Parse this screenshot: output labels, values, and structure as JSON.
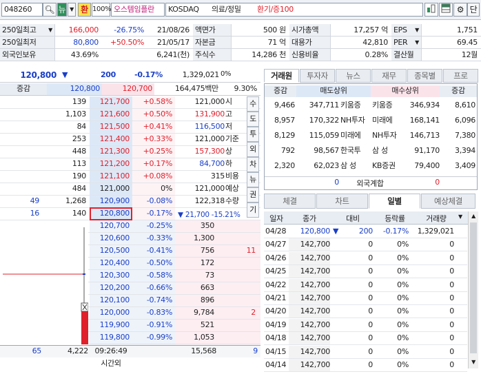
{
  "topbar": {
    "code": "048260",
    "search_icon": "search-icon",
    "new_label": "뉴",
    "hwan_label": "환",
    "pct": "100%",
    "name": "오스템임플란",
    "market": "KOSDAQ",
    "sector": "의료/정밀",
    "status": "환기/증100",
    "dan": "단"
  },
  "info": {
    "r1": {
      "l1": "250일최고",
      "v1": "166,000",
      "p1": "-26.75%",
      "d1": "21/08/26",
      "l2": "액면가",
      "v2": "500 원",
      "l3": "시가총액",
      "v3": "17,257 억",
      "l4": "EPS",
      "v4": "1,751"
    },
    "r2": {
      "l1": "250일최저",
      "v1": "80,800",
      "p1": "+50.50%",
      "d1": "21/05/17",
      "l2": "자본금",
      "v2": "71 억",
      "l3": "대용가",
      "v3": "42,810",
      "l4": "PER",
      "v4": "69.45"
    },
    "r3": {
      "l1": "외국인보유",
      "v1": "43.69%",
      "v1b": "6,241(천)",
      "l2": "주식수",
      "v2": "14,286 천",
      "l3": "신용비율",
      "v3": "0.28%",
      "l4": "결산월",
      "v4": "12월"
    }
  },
  "quote": {
    "price": "120,800",
    "arrow": "▼",
    "change": "200",
    "rate": "-0.17%",
    "volume": "1,329,021",
    "vol_pct": "0%",
    "label_inc": "증감",
    "ask_best": "120,800",
    "bid_best": "120,700",
    "amount": "164,475백만",
    "ratio": "9.30%"
  },
  "asks": [
    {
      "vol": "139",
      "price": "121,700",
      "rate": "+0.58%"
    },
    {
      "vol": "1,103",
      "price": "121,600",
      "rate": "+0.50%"
    },
    {
      "vol": "84",
      "price": "121,500",
      "rate": "+0.41%"
    },
    {
      "vol": "253",
      "price": "121,400",
      "rate": "+0.33%"
    },
    {
      "vol": "448",
      "price": "121,300",
      "rate": "+0.25%"
    },
    {
      "vol": "113",
      "price": "121,200",
      "rate": "+0.17%"
    },
    {
      "vol": "190",
      "price": "121,100",
      "rate": "+0.08%"
    },
    {
      "vol": "484",
      "price": "121,000",
      "rate": "0%"
    },
    {
      "chg": "49",
      "vol": "1,268",
      "price": "120,900",
      "rate": "-0.08%"
    },
    {
      "chg": "16",
      "vol": "140",
      "price": "120,800",
      "rate": "-0.17%"
    }
  ],
  "bids": [
    {
      "price": "120,700",
      "rate": "-0.25%",
      "vol": "350",
      "chg": ""
    },
    {
      "price": "120,600",
      "rate": "-0.33%",
      "vol": "1,300",
      "chg": ""
    },
    {
      "price": "120,500",
      "rate": "-0.41%",
      "vol": "756",
      "chg": "11"
    },
    {
      "price": "120,400",
      "rate": "-0.50%",
      "vol": "172",
      "chg": ""
    },
    {
      "price": "120,300",
      "rate": "-0.58%",
      "vol": "73",
      "chg": ""
    },
    {
      "price": "120,200",
      "rate": "-0.66%",
      "vol": "663",
      "chg": ""
    },
    {
      "price": "120,100",
      "rate": "-0.74%",
      "vol": "896",
      "chg": ""
    },
    {
      "price": "120,000",
      "rate": "-0.83%",
      "vol": "9,784",
      "chg": "2"
    },
    {
      "price": "119,900",
      "rate": "-0.91%",
      "vol": "521",
      "chg": ""
    },
    {
      "price": "119,800",
      "rate": "-0.99%",
      "vol": "1,053",
      "chg": ""
    }
  ],
  "ohlc": [
    {
      "v": "121,000",
      "l": "시"
    },
    {
      "v": "131,900",
      "l": "고"
    },
    {
      "v": "116,500",
      "l": "저"
    },
    {
      "v": "121,000",
      "l": "기준"
    },
    {
      "v": "157,300",
      "l": "상"
    },
    {
      "v": "84,700",
      "l": "하"
    },
    {
      "v": "315",
      "l": "비용"
    },
    {
      "v": "121,000",
      "l": "예상"
    },
    {
      "v": "122,318",
      "l": "수량"
    }
  ],
  "expected_change": "▼ 21,700 -15.21%",
  "side_buttons": [
    "수",
    "도",
    "투",
    "외",
    "차",
    "뉴",
    "권",
    "기"
  ],
  "footer": {
    "left": "65",
    "total_ask": "4,222",
    "time": "09:26:49",
    "total_bid": "15,568",
    "right": "9",
    "after": "시간외"
  },
  "tabs1": [
    "거래원",
    "투자자",
    "뉴스",
    "재무",
    "종목별",
    "프로"
  ],
  "broker_head": {
    "inc": "증감",
    "sell": "매도상위",
    "buy": "매수상위",
    "inc2": "증감"
  },
  "brokers": [
    {
      "sc": "9,466",
      "sv": "347,711",
      "sn": "키움증",
      "bn": "키움증",
      "bv": "346,934",
      "bc": "8,610"
    },
    {
      "sc": "8,957",
      "sv": "170,322",
      "sn": "NH투자",
      "bn": "미래에",
      "bv": "168,141",
      "bc": "6,096"
    },
    {
      "sc": "8,129",
      "sv": "115,059",
      "sn": "미래에",
      "bn": "NH투자",
      "bv": "146,713",
      "bc": "7,380"
    },
    {
      "sc": "792",
      "sv": "98,567",
      "sn": "한국투",
      "bn": "삼  성",
      "bv": "91,170",
      "bc": "3,394"
    },
    {
      "sc": "2,320",
      "sv": "62,023",
      "sn": "삼  성",
      "bn": "KB증권",
      "bv": "79,400",
      "bc": "3,409"
    }
  ],
  "foreign_total": {
    "sell": "0",
    "label": "외국계합",
    "buy": "0"
  },
  "tabs2": [
    "체결",
    "차트",
    "일별",
    "예상체결"
  ],
  "daily_head": [
    "일자",
    "종가",
    "대비",
    "등락률",
    "거래량"
  ],
  "daily": [
    {
      "d": "04/28",
      "c": "120,800",
      "a": "▼",
      "v": "200",
      "r": "-0.17%",
      "q": "1,329,021"
    },
    {
      "d": "04/27",
      "c": "142,700",
      "a": "",
      "v": "0",
      "r": "0%",
      "q": "0"
    },
    {
      "d": "04/26",
      "c": "142,700",
      "a": "",
      "v": "0",
      "r": "0%",
      "q": "0"
    },
    {
      "d": "04/25",
      "c": "142,700",
      "a": "",
      "v": "0",
      "r": "0%",
      "q": "0"
    },
    {
      "d": "04/22",
      "c": "142,700",
      "a": "",
      "v": "0",
      "r": "0%",
      "q": "0"
    },
    {
      "d": "04/21",
      "c": "142,700",
      "a": "",
      "v": "0",
      "r": "0%",
      "q": "0"
    },
    {
      "d": "04/20",
      "c": "142,700",
      "a": "",
      "v": "0",
      "r": "0%",
      "q": "0"
    },
    {
      "d": "04/19",
      "c": "142,700",
      "a": "",
      "v": "0",
      "r": "0%",
      "q": "0"
    },
    {
      "d": "04/18",
      "c": "142,700",
      "a": "",
      "v": "0",
      "r": "0%",
      "q": "0"
    },
    {
      "d": "04/15",
      "c": "142,700",
      "a": "",
      "v": "0",
      "r": "0%",
      "q": "0"
    },
    {
      "d": "04/14",
      "c": "142,700",
      "a": "",
      "v": "0",
      "r": "0%",
      "q": "0"
    }
  ],
  "colors": {
    "up": "#e0202b",
    "down": "#1a3fc8",
    "ask_bg": "#dde8f7",
    "bid_bg": "#fbe3ea"
  }
}
